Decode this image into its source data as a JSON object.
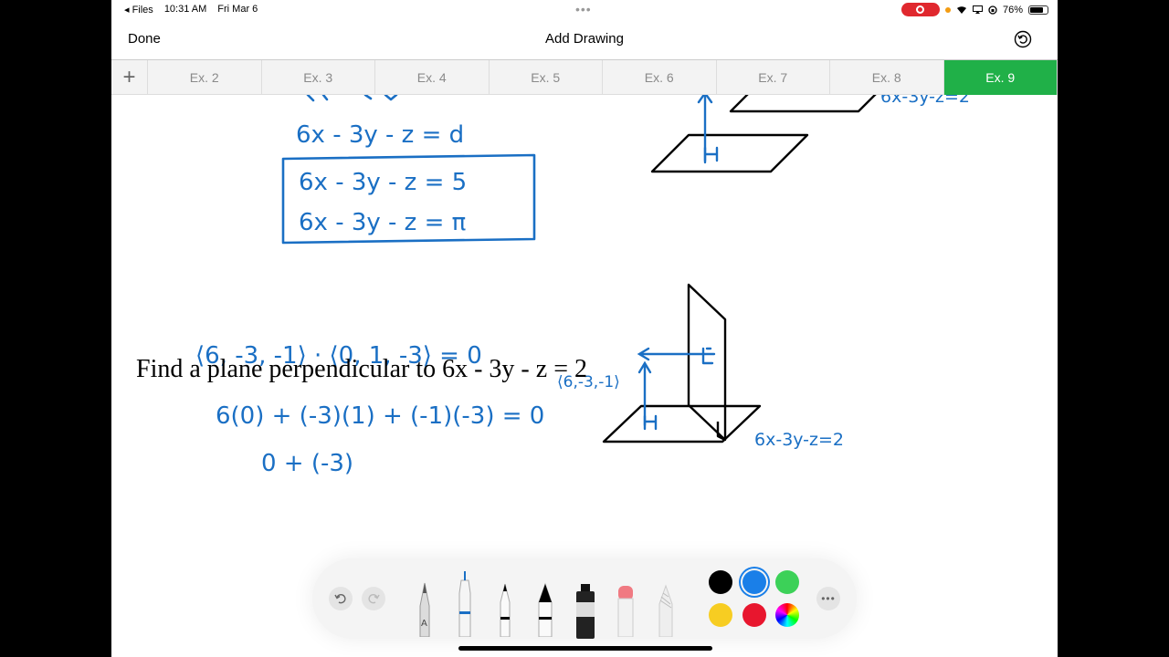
{
  "status": {
    "back_app": "◂ Files",
    "time": "10:31 AM",
    "date": "Fri Mar 6",
    "battery": "76%",
    "battery_level": 0.76
  },
  "nav": {
    "done_label": "Done",
    "title": "Add Drawing"
  },
  "tabs": [
    "Ex. 2",
    "Ex. 3",
    "Ex. 4",
    "Ex. 5",
    "Ex. 6",
    "Ex. 7",
    "Ex. 8",
    "Ex. 9"
  ],
  "active_tab": "Ex. 9",
  "canvas": {
    "typed_prompt": "Find a plane perpendicular to 6x - 3y - z = 2",
    "handwritten": [
      "6x - 3y - z = d",
      "6x - 3y - z = 5",
      "6x - 3y - z = π",
      "⟨6, -3, -1⟩ · ⟨0, 1, -3⟩ = 0",
      "6(0) + (-3)(1) + (-1)(-3) = 0",
      "0 + (-3)",
      "⟨6,-3,-1⟩",
      "6x-3y-z=2",
      "6x-3y-z=2"
    ]
  },
  "toolbar": {
    "tools": [
      "pen",
      "monoline",
      "marker",
      "fountain-pen",
      "watercolor",
      "eraser",
      "pencil"
    ],
    "colors": [
      "#000000",
      "#1a7fe8",
      "#3cd158",
      "#f7cd22",
      "#e8162e",
      "multicolor"
    ],
    "selected_color": "#1a7fe8"
  },
  "colors": {
    "ink": "#1a6fc4",
    "active_tab": "#20b048"
  }
}
